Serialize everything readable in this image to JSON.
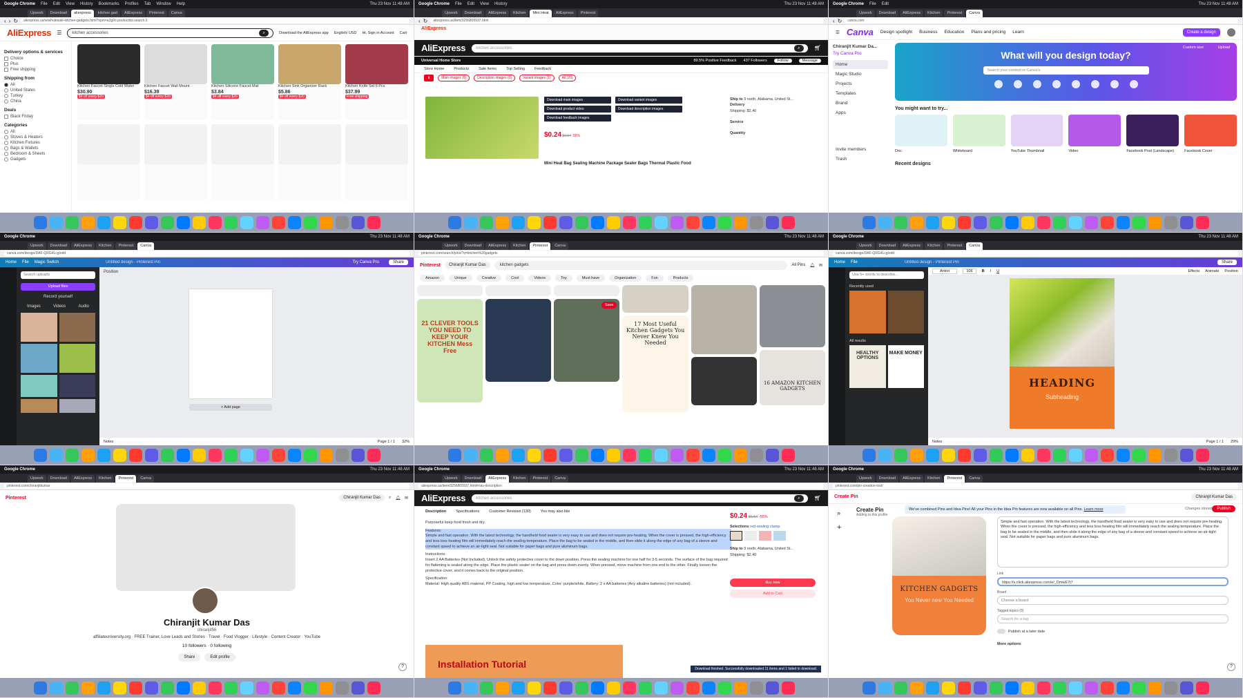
{
  "menubar": {
    "app": "Google Chrome",
    "items": [
      "File",
      "Edit",
      "View",
      "History",
      "Bookmarks",
      "Profiles",
      "Tab",
      "Window",
      "Help"
    ],
    "clock": "Thu 23 Nov 11:48 AM"
  },
  "panels": {
    "p1": {
      "tabs": [
        "Upwork",
        "Download",
        "aliexpress",
        "kitchen gad",
        "AliExpress",
        "Pinterest",
        "Canva"
      ],
      "url": "aliexpress.us/w/wholesale-kitchen-gadgets.html?spm=a2g0o.productlist.search.0",
      "logo": "AliExpress",
      "search": "kitchen accessories",
      "header_right": [
        "Download the AliExpress app",
        "English/ USD",
        "Hi, Sign in Account",
        "Cart"
      ],
      "filters": {
        "title": "Delivery options & services",
        "delivery": [
          "Choice",
          "Plus",
          "Free shipping"
        ],
        "ship_from_title": "Shipping from",
        "ship_from": [
          "All",
          "United States",
          "Turkey",
          "China"
        ],
        "deals_title": "Deals",
        "deals": [
          "Black Friday"
        ],
        "categories_title": "Categories",
        "categories": [
          "All",
          "Stoves & Heaters",
          "Kitchen Fixtures",
          "Bags & Wallets",
          "Bedroom & Sheets",
          "Gadgets"
        ]
      },
      "products": [
        {
          "title": "Kitchen Faucet Single Cold Water",
          "price": "$30.90",
          "badge": "$4 off every $20"
        },
        {
          "title": "Kitchen Faucet Wall Mount",
          "price": "$16.39",
          "badge": "$4 off every $20"
        },
        {
          "title": "Kitchen Silicone Faucet Mat",
          "price": "$3.84",
          "badge": "$4 off every $20"
        },
        {
          "title": "Kitchen Sink Organizer Rack",
          "price": "$5.86",
          "badge": "$4 off every $20"
        },
        {
          "title": "Kitchen Knife Set 6 Pcs",
          "price": "$37.99",
          "badge": "Free shipping"
        }
      ]
    },
    "p2": {
      "tabs": [
        "Upwork",
        "Download",
        "AliExpress",
        "Kitchen",
        "Mini Heat",
        "AliExpress",
        "Pinterest"
      ],
      "url": "aliexpress.us/item/3256805937.html",
      "notice_left": "AliExpress",
      "logo": "AliExpress",
      "search_placeholder": "kitchen accessories",
      "store": "Universal Home Store",
      "positive": "89.5% Positive Feedback",
      "followers": "437 Followers",
      "follow_btn": "Follow",
      "message_btn": "Message",
      "storenav": [
        "Store Home",
        "Products",
        "Sale Items",
        "Top Selling",
        "Feedback"
      ],
      "dl_tabs": [
        "Main images (6)",
        "Description images (0)",
        "Variant images (1)",
        "All (20)"
      ],
      "dl_menu": [
        "Download main images",
        "Download variant images",
        "Download product video",
        "Download description images",
        "Download feedback images"
      ],
      "price": "$0.24",
      "old_price": "$0.54",
      "discount": "-55%",
      "ship_to": "Ship to",
      "ship_addr": "3 north, Alabama, United St...",
      "delivery": "Delivery",
      "shipping_price": "Shipping: $2.40",
      "service": "Service",
      "quantity": "Quantity",
      "title": "Mini Heat Bag Sealing Machine Package Sealer Bags Thermal Plastic Food"
    },
    "p3": {
      "tabs": [
        "Upwork",
        "Download",
        "AliExpress",
        "Kitchen",
        "Pinterest",
        "Canva"
      ],
      "url": "canva.com",
      "logo": "Canva",
      "nav": [
        "Design spotlight",
        "Business",
        "Education",
        "Plans and pricing",
        "Learn"
      ],
      "create": "Create a design",
      "user": "Chiranjit Kumar Da...",
      "try_pro": "Try Canva Pro",
      "side_items": [
        "Home",
        "Magic Studio",
        "Projects",
        "Templates",
        "Brand",
        "Apps"
      ],
      "invite": "Invite members",
      "trash": "Trash",
      "hero_title": "What will you design today?",
      "hero_search": "Search your content or Canva's",
      "try_label": "You might want to try...",
      "cards": [
        "Doc",
        "Whiteboard",
        "YouTube Thumbnail",
        "Video",
        "Facebook Post (Landscape)",
        "Facebook Cover"
      ],
      "recent": "Recent designs",
      "custom": "Custom size",
      "upload": "Upload"
    },
    "p4": {
      "tabs": [
        "Upwork",
        "Download",
        "AliExpress",
        "Kitchen",
        "Pinterest",
        "Canva"
      ],
      "url": "canva.com/design/DAF-QRG4Lcg/edit",
      "home": "Home",
      "file": "File",
      "magic": "Magic Switch",
      "title": "Untitled design - Pinterest Pin",
      "try_pro": "Try Canva Pro",
      "share": "Share",
      "search": "Search uploads",
      "upload": "Upload files",
      "record": "Record yourself",
      "tabs_inner": [
        "Images",
        "Videos",
        "Audio"
      ],
      "position": "Position",
      "add_page": "+ Add page",
      "notes": "Notes",
      "page": "Page 1 / 1",
      "zoom": "32%"
    },
    "p5": {
      "tabs": [
        "Upwork",
        "Download",
        "AliExpress",
        "Kitchen",
        "Pinterest",
        "Canva"
      ],
      "url": "pinterest.com/search/pins/?q=kitchen%20gadgets",
      "logo": "Pinterest",
      "user": "Chiranjit Kumar Das",
      "search": "kitchen gadgets",
      "all_pins": "All Pins",
      "chips": [
        "Amazon",
        "Unique",
        "Creative",
        "Cool",
        "Videos",
        "Toy",
        "Must have",
        "Organization",
        "Fun",
        "Products"
      ],
      "pin_texts": [
        "21 CLEVER TOOLS YOU NEED TO KEEP YOUR KITCHEN Mess Free",
        "17 Most Useful Kitchen Gadgets You Never Knew You Needed",
        "16 AMAZON KITCHEN GADGETS"
      ],
      "save": "Save"
    },
    "p6": {
      "tabs": [
        "Upwork",
        "Download",
        "AliExpress",
        "Kitchen",
        "Pinterest",
        "Canva"
      ],
      "url": "canva.com/design/DAF-QRG4Lcg/edit",
      "title": "Untitled design - Pinterest Pin",
      "font": "Anton",
      "font_size": "106",
      "effects": "Effects",
      "animate": "Animate",
      "position": "Position",
      "search": "Use 5+ words to describe...",
      "recently_used": "Recently used",
      "all_results": "All results",
      "template_a": "HEALTHY OPTIONS",
      "template_b": "MAKE MONEY",
      "heading": "HEADING",
      "subheading": "Subheading",
      "notes": "Notes",
      "page": "Page 1 / 1",
      "zoom": "29%"
    },
    "p7": {
      "tabs": [
        "Upwork",
        "Download",
        "AliExpress",
        "Kitchen",
        "Pinterest",
        "Canva"
      ],
      "url": "pinterest.com/chiranjitkumar",
      "logo": "Pinterest",
      "user": "Chiranjit Kumar Das",
      "name": "Chiranjit Kumar Das",
      "handle": "chiranjit56",
      "bio": "affiliateuniversity.org · FREE Trainer, Love Leads and Stories · Travel · Food Vlogger · Lifestyle · Content Creator · YouTube",
      "follow": "10 followers · 0 following",
      "share": "Share",
      "edit": "Edit profile",
      "help": "?"
    },
    "p8": {
      "tabs": [
        "Upwork",
        "Download",
        "AliExpress",
        "Kitchen",
        "Pinterest",
        "Canva"
      ],
      "url": "aliexpress.us/item/3256805937.html#nav-description",
      "logo": "AliExpress",
      "search_placeholder": "kitchen accessories",
      "desc_tabs": [
        "Description",
        "Specifications",
        "Customer Reviews (130)",
        "You may also like"
      ],
      "desc_intro": "Purposeful keep food fresh and dry.",
      "features": "Features:",
      "features_text": "Simple and fast operation. With the latest technology, the handheld food sealer is very easy to use and does not require pre-heating. When the cover is pressed, the high-efficiency and less loss heating film will immediately reach the sealing temperature. Place the bag to be sealed in the middle, and then slide it along the edge of any bag of a sleeve and constant speed to achieve an air-tight seal. Not suitable for paper bags and pure aluminum bags.",
      "instructions": "Instructions:",
      "instructions_text": "Insert 2 AA Batteries (Not Included). Unlock the safety protective cover to the down position. Press the sealing machine for one half for 3-5 seconds. The surface of the bag required for flattening is sealed along the edge. Place the plastic sealer on the bag and press down evenly. When pressed, move machine from one end to the other. Finally loosen the protective cover, and it comes back to the original position.",
      "spec": "Specification:",
      "spec_text": "Material: High quality ABS material, PP Coating, high and low temperature. Color: purple/white. Battery: 2 x AA batteries (Any alkaline batteries) (not included).",
      "install": "Installation Tutorial",
      "price": "$0.24",
      "old_price": "$0.54",
      "discount": "-55%",
      "selections": "Selections",
      "variant": "red-sealing clamp",
      "ship_to": "Ship to",
      "ship_addr": "3 north, Alabama, United St...",
      "shipping": "Shipping: $2.40",
      "buy": "Buy now",
      "cart": "Add to Cart",
      "toast": "Download finished. Successfully downloaded 11 items and 1 failed to download."
    },
    "p9": {
      "tabs": [
        "Upwork",
        "Download",
        "AliExpress",
        "Kitchen",
        "Pinterest",
        "Canva"
      ],
      "url": "pinterest.com/pin-creation-tool/",
      "logo": "Create Pin",
      "user": "Chiranjit Kumar Das",
      "title": "Create Pin",
      "subtitle": "Adding to this profile",
      "banner": "We've combined Pins and Idea Pins! All your Pins in the Idea Pin features are now available on all Pins.",
      "learn": "Learn more",
      "changes": "Changes stored",
      "publish": "Publish",
      "pin_text1": "KITCHEN GADGETS",
      "pin_text2": "You Never new You Needed",
      "desc": "Simple and fast operation. With the latest technology, the handheld food sealer is very easy to use and does not require pre-heating. When the cover is pressed, the high-efficiency and less loss heating film will immediately reach the sealing temperature. Place the bag to be sealed in the middle, and then slide it along the edge of any bag of a sleeve and constant speed to achieve an air-tight seal. Not suitable for paper bags and pure aluminum bags.",
      "link_label": "Link",
      "link_value": "https://s.click.aliexpress.com/e/_DmwE7t7",
      "board_label": "Board",
      "board_value": "Choose a board",
      "tagged_label": "Tagged topics (0)",
      "tagged_value": "Search for a tag",
      "publish_later": "Publish at a later date",
      "more": "More options"
    }
  },
  "colors": {
    "ae_red": "#e62e04",
    "canva_purple": "#8b3dff",
    "pin_red": "#e60023"
  },
  "dock_colors": [
    "#2c7be5",
    "#4ab3f4",
    "#35c759",
    "#ff9f0a",
    "#1da1f2",
    "#ffd60a",
    "#ff3b30",
    "#5e5ce6",
    "#34c759",
    "#007aff",
    "#ffcc00",
    "#ff375f",
    "#30d158",
    "#64d2ff",
    "#bf5af2",
    "#ff453a",
    "#0a84ff",
    "#32d74b",
    "#ff9500",
    "#8e8e93",
    "#5856d6",
    "#ff2d55"
  ]
}
